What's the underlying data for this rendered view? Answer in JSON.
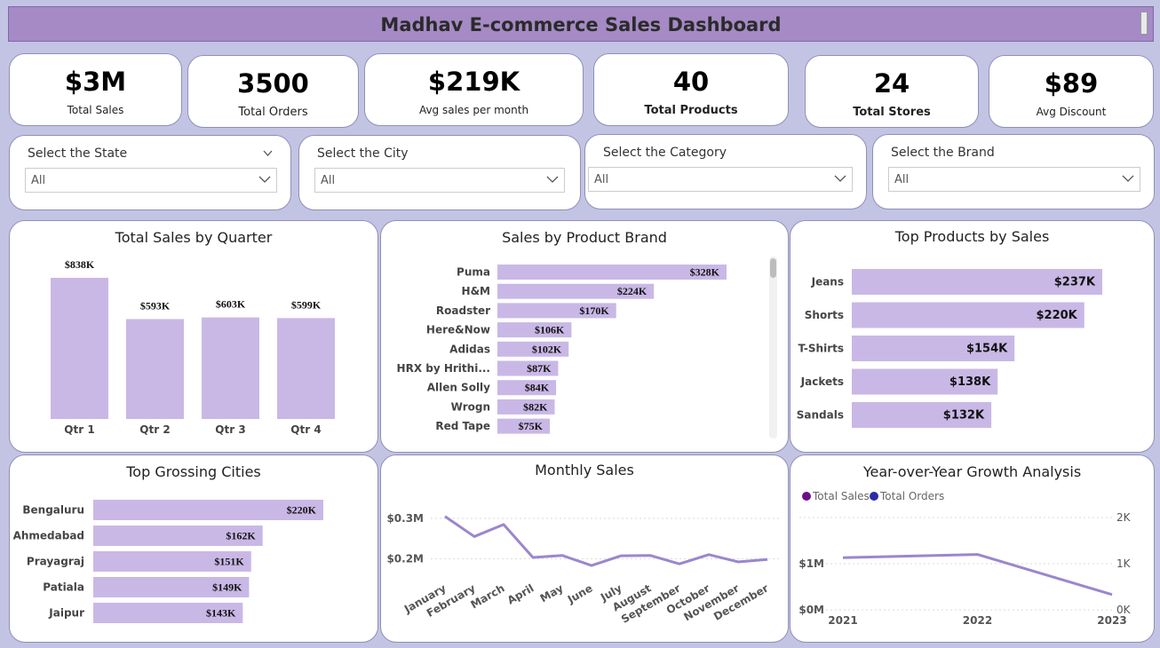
{
  "header": {
    "title": "Madhav E-commerce Sales Dashboard"
  },
  "kpis": [
    {
      "value": "$3M",
      "label": "Total Sales"
    },
    {
      "value": "3500",
      "label": "Total Orders"
    },
    {
      "value": "$219K",
      "label": "Avg sales per month"
    },
    {
      "value": "40",
      "label": "Total Products"
    },
    {
      "value": "24",
      "label": "Total Stores"
    },
    {
      "value": "$89",
      "label": "Avg Discount"
    }
  ],
  "slicers": [
    {
      "label": "Select the State",
      "value": "All"
    },
    {
      "label": "Select the City",
      "value": "All"
    },
    {
      "label": "Select the Category",
      "value": "All"
    },
    {
      "label": "Select the Brand",
      "value": "All"
    }
  ],
  "colors": {
    "bar": "#c9b8e6",
    "line": "#9b86cd",
    "total_sales_legend": "#6b0f8a",
    "total_orders_legend": "#2c2ca8"
  },
  "chart_data": [
    {
      "id": "quarter",
      "type": "bar",
      "title": "Total Sales by Quarter",
      "categories": [
        "Qtr 1",
        "Qtr 2",
        "Qtr 3",
        "Qtr 4"
      ],
      "values": [
        838,
        593,
        603,
        599
      ],
      "labels": [
        "$838K",
        "$593K",
        "$603K",
        "$599K"
      ],
      "ylim": [
        0,
        838
      ]
    },
    {
      "id": "brand",
      "type": "bar",
      "orientation": "horizontal",
      "title": "Sales by Product Brand",
      "categories": [
        "Puma",
        "H&M",
        "Roadster",
        "Here&Now",
        "Adidas",
        "HRX by Hrithi...",
        "Allen Solly",
        "Wrogn",
        "Red Tape"
      ],
      "values": [
        328,
        224,
        170,
        106,
        102,
        87,
        84,
        82,
        75
      ],
      "labels": [
        "$328K",
        "$224K",
        "$170K",
        "$106K",
        "$102K",
        "$87K",
        "$84K",
        "$82K",
        "$75K"
      ],
      "xlim": [
        0,
        328
      ]
    },
    {
      "id": "products",
      "type": "bar",
      "orientation": "horizontal",
      "title": "Top Products by Sales",
      "categories": [
        "Jeans",
        "Shorts",
        "T-Shirts",
        "Jackets",
        "Sandals"
      ],
      "values": [
        237,
        220,
        154,
        138,
        132
      ],
      "labels": [
        "$237K",
        "$220K",
        "$154K",
        "$138K",
        "$132K"
      ],
      "xlim": [
        0,
        237
      ]
    },
    {
      "id": "cities",
      "type": "bar",
      "orientation": "horizontal",
      "title": "Top Grossing Cities",
      "categories": [
        "Bengaluru",
        "Ahmedabad",
        "Prayagraj",
        "Patiala",
        "Jaipur"
      ],
      "values": [
        220,
        162,
        151,
        149,
        143
      ],
      "labels": [
        "$220K",
        "$162K",
        "$151K",
        "$149K",
        "$143K"
      ],
      "xlim": [
        0,
        220
      ]
    },
    {
      "id": "monthly",
      "type": "line",
      "title": "Monthly Sales",
      "x": [
        "January",
        "February",
        "March",
        "April",
        "May",
        "June",
        "July",
        "August",
        "September",
        "October",
        "November",
        "December"
      ],
      "values": [
        0.305,
        0.255,
        0.285,
        0.203,
        0.208,
        0.183,
        0.207,
        0.208,
        0.187,
        0.21,
        0.192,
        0.198
      ],
      "yticks": [
        "$0.2M",
        "$0.3M"
      ],
      "ylim": [
        0.15,
        0.32
      ]
    },
    {
      "id": "yoy",
      "type": "line",
      "title": "Year-over-Year Growth Analysis",
      "x": [
        "2021",
        "2022",
        "2023"
      ],
      "series": [
        {
          "name": "Total Sales",
          "values": [
            1.13,
            1.2,
            0.33
          ]
        },
        {
          "name": "Total Orders",
          "values": [
            1230,
            1310,
            360
          ]
        }
      ],
      "left_ticks": [
        "$0M",
        "$1M"
      ],
      "right_ticks": [
        "0K",
        "1K",
        "2K"
      ],
      "ylim_left": [
        0,
        2
      ],
      "ylim_right": [
        0,
        2000
      ]
    }
  ]
}
